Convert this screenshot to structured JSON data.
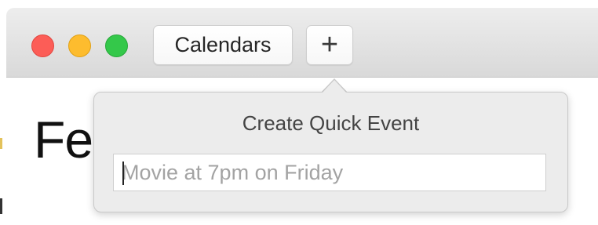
{
  "window": {
    "toolbar": {
      "calendars_label": "Calendars",
      "add_label": "+"
    },
    "content": {
      "visible_text": "Fe"
    }
  },
  "quick_event_popover": {
    "title": "Create Quick Event",
    "input_value": "",
    "input_placeholder": "Movie at 7pm on Friday"
  },
  "colors": {
    "close": "#fc5d57",
    "minimize": "#fdbc2e",
    "maximize": "#34c84a"
  }
}
